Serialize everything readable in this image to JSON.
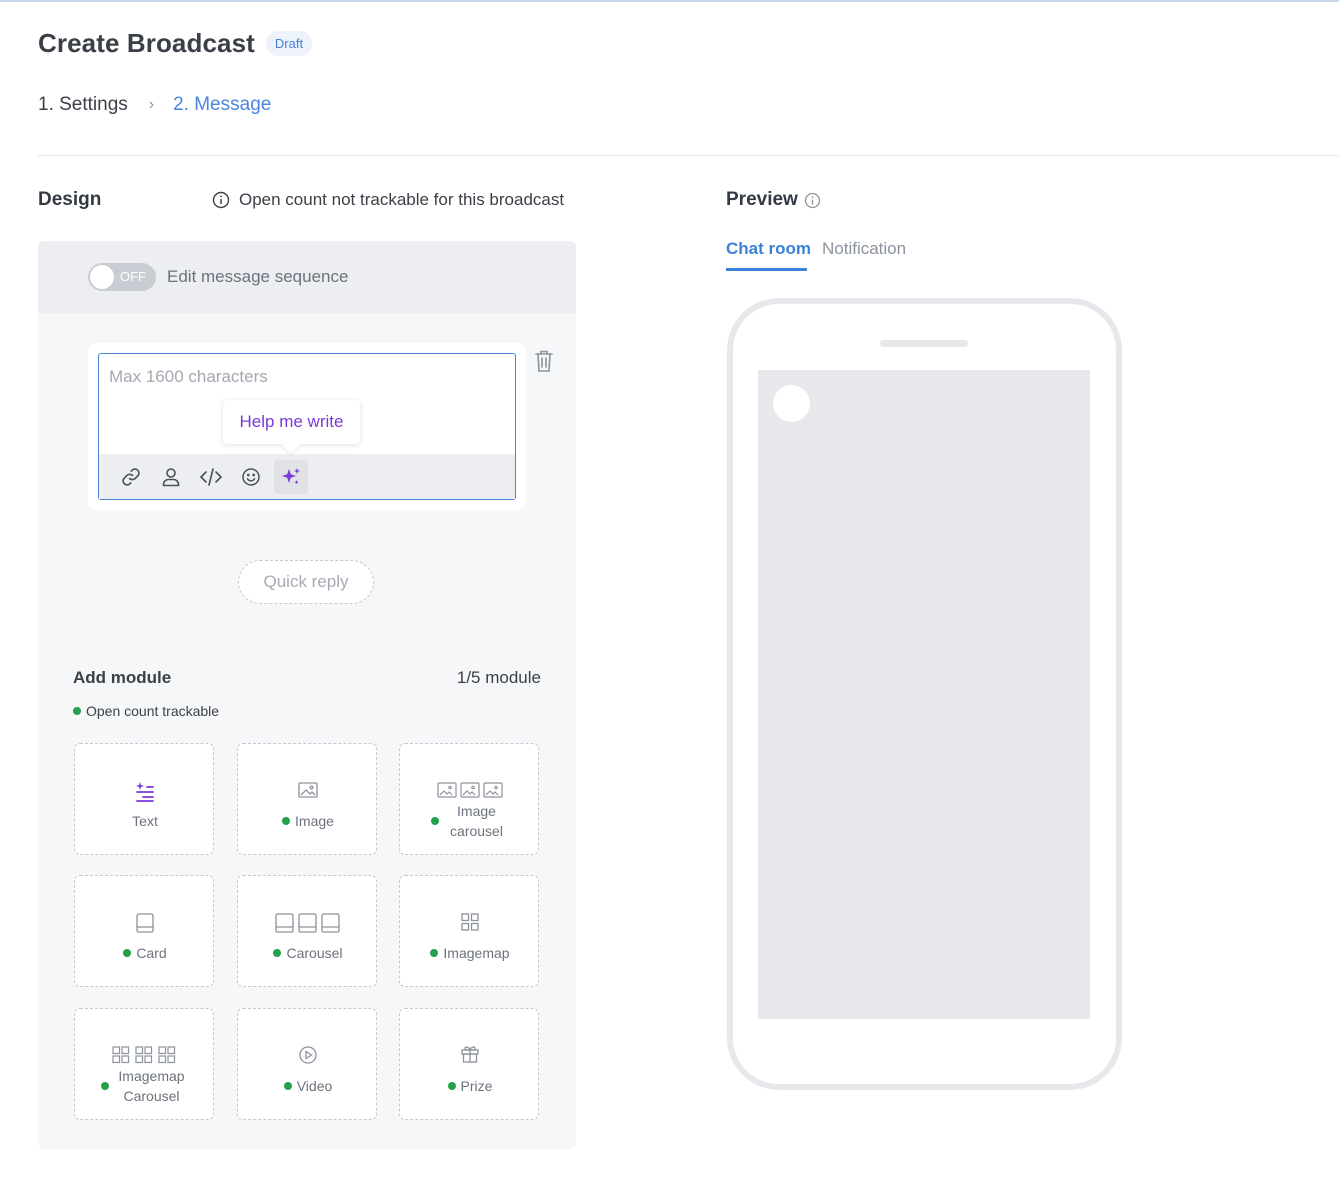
{
  "header": {
    "title": "Create Broadcast",
    "badge": "Draft"
  },
  "stepper": {
    "steps": [
      {
        "label": "1. Settings"
      },
      {
        "label": "2. Message"
      }
    ],
    "separator": "›"
  },
  "design": {
    "title": "Design",
    "notice": "Open count not trackable for this broadcast",
    "sequence_toggle": {
      "state": "OFF",
      "label": "Edit message sequence"
    },
    "editor": {
      "placeholder": "Max 1600 characters",
      "tooltip": "Help me write",
      "toolbar": [
        "link-icon",
        "person-icon",
        "code-icon",
        "emoji-icon",
        "sparkle-icon"
      ]
    },
    "quick_reply": "Quick reply",
    "add_module": {
      "title": "Add module",
      "count": "1/5 module",
      "trackable_note": "Open count trackable",
      "modules": [
        {
          "label": "Text",
          "trackable": false,
          "icon": "text-sparkle-icon"
        },
        {
          "label": "Image",
          "trackable": true,
          "icon": "image-icon"
        },
        {
          "label": "Image carousel",
          "trackable": true,
          "icon": "image-carousel-icon"
        },
        {
          "label": "Card",
          "trackable": true,
          "icon": "card-icon"
        },
        {
          "label": "Carousel",
          "trackable": true,
          "icon": "carousel-icon"
        },
        {
          "label": "Imagemap",
          "trackable": true,
          "icon": "grid-icon"
        },
        {
          "label": "Imagemap Carousel",
          "trackable": true,
          "icon": "grid-carousel-icon"
        },
        {
          "label": "Video",
          "trackable": true,
          "icon": "play-icon"
        },
        {
          "label": "Prize",
          "trackable": true,
          "icon": "gift-icon"
        }
      ]
    }
  },
  "preview": {
    "title": "Preview",
    "tabs": [
      {
        "label": "Chat room",
        "active": true
      },
      {
        "label": "Notification",
        "active": false
      }
    ]
  },
  "colors": {
    "accent": "#4a86dd",
    "ai_purple": "#7a3ad8",
    "trackable_green": "#22a04a"
  }
}
